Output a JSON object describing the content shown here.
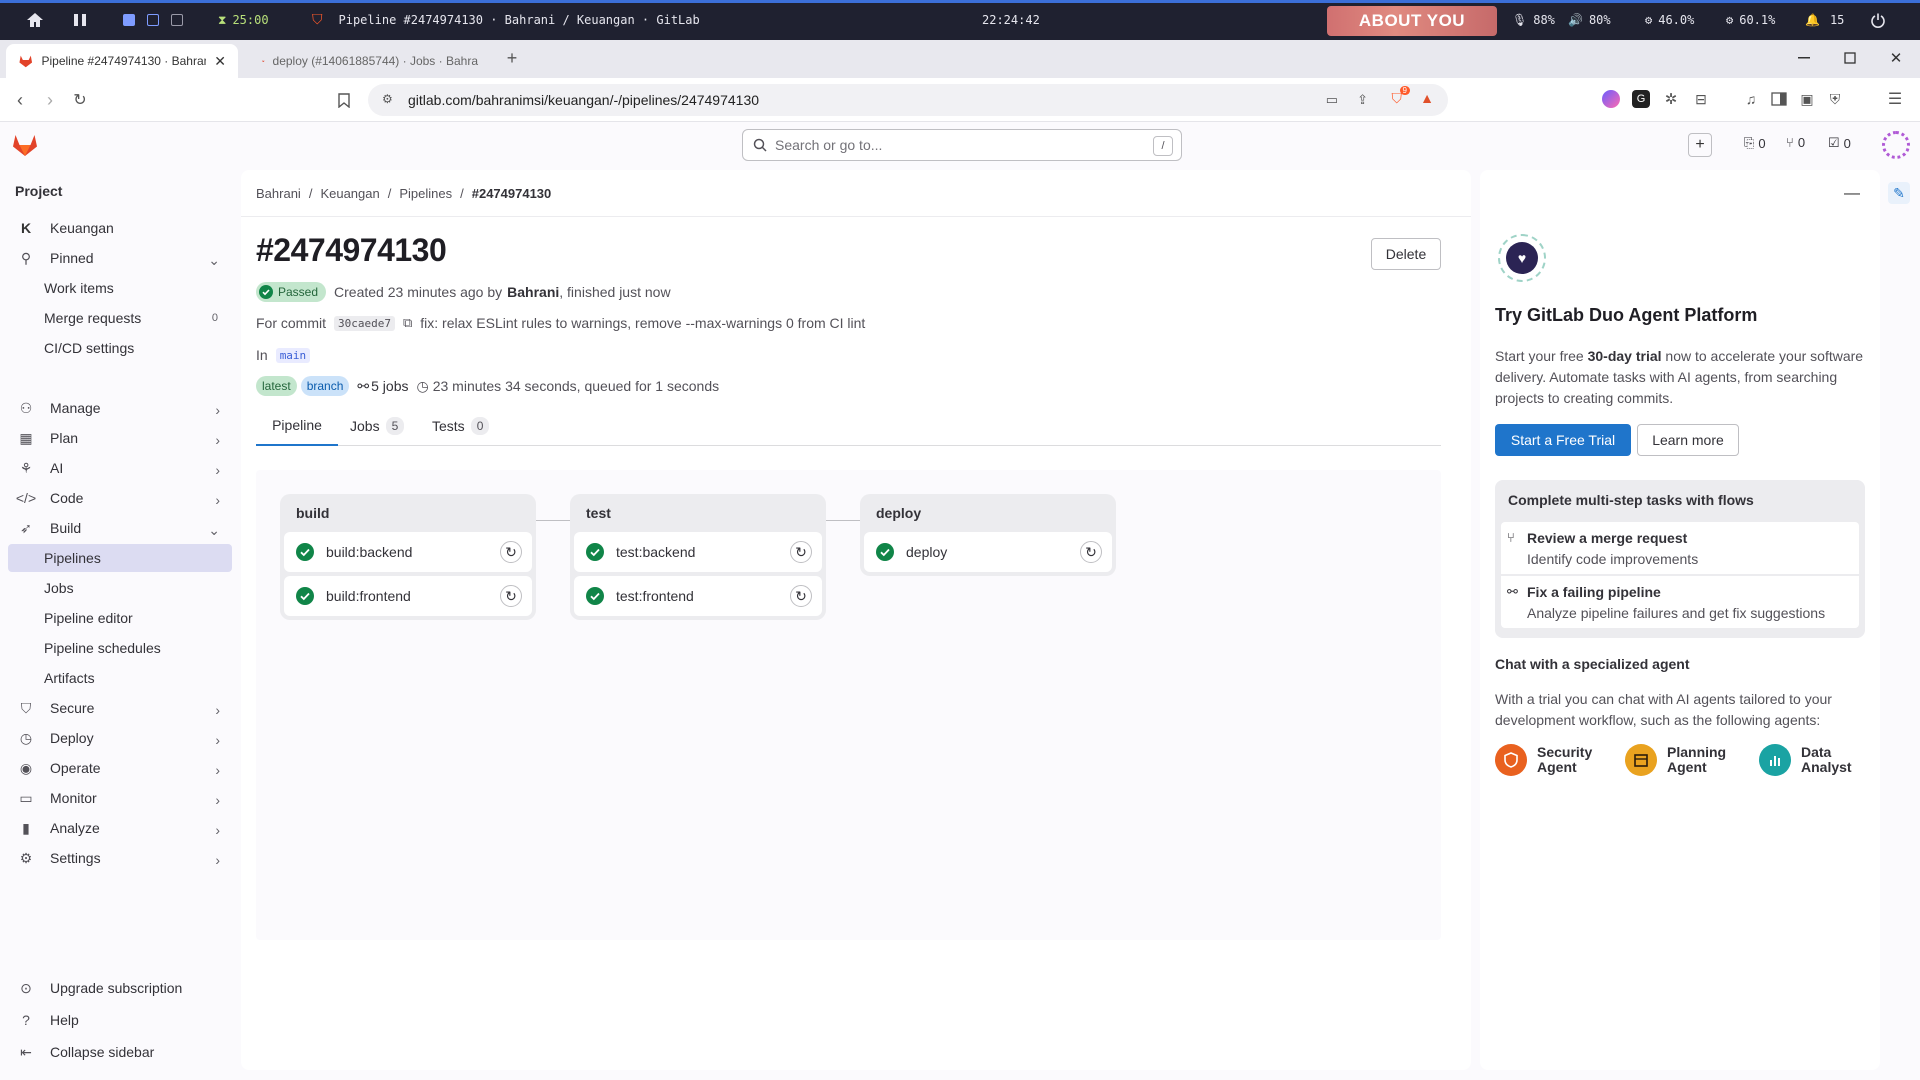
{
  "system": {
    "timer": "25:00",
    "window_title": "Pipeline #2474974130 · Bahrani / Keuangan · GitLab",
    "clock": "22:24:42",
    "media": "ABOUT YOU",
    "mic": "88%",
    "volume": "80%",
    "cpu": "46.0%",
    "mem": "60.1%",
    "notifications": "15"
  },
  "browser": {
    "tabs": [
      {
        "label": "Pipeline #2474974130 · Bahrani /"
      },
      {
        "label": "deploy (#14061885744) · Jobs · Bahra"
      }
    ],
    "url": "gitlab.com/bahranimsi/keuangan/-/pipelines/2474974130",
    "shield_badge": "9"
  },
  "header": {
    "search_placeholder": "Search or go to...",
    "search_shortcut": "/",
    "issues_count": "0",
    "mr_count": "0",
    "todos_count": "0"
  },
  "sidebar": {
    "title": "Project",
    "project_initial": "K",
    "project_name": "Keuangan",
    "pinned": "Pinned",
    "pinned_items": [
      {
        "label": "Work items"
      },
      {
        "label": "Merge requests",
        "count": "0"
      },
      {
        "label": "CI/CD settings"
      }
    ],
    "sections": [
      {
        "label": "Manage"
      },
      {
        "label": "Plan"
      },
      {
        "label": "AI"
      },
      {
        "label": "Code"
      },
      {
        "label": "Build"
      }
    ],
    "build_items": [
      {
        "label": "Pipelines"
      },
      {
        "label": "Jobs"
      },
      {
        "label": "Pipeline editor"
      },
      {
        "label": "Pipeline schedules"
      },
      {
        "label": "Artifacts"
      }
    ],
    "sections2": [
      {
        "label": "Secure"
      },
      {
        "label": "Deploy"
      },
      {
        "label": "Operate"
      },
      {
        "label": "Monitor"
      },
      {
        "label": "Analyze"
      },
      {
        "label": "Settings"
      }
    ],
    "footer": [
      {
        "label": "Upgrade subscription"
      },
      {
        "label": "Help"
      },
      {
        "label": "Collapse sidebar"
      }
    ]
  },
  "main": {
    "breadcrumb": [
      "Bahrani",
      "Keuangan",
      "Pipelines",
      "#2474974130"
    ],
    "title": "#2474974130",
    "delete_label": "Delete",
    "status": "Passed",
    "created_prefix": "Created 23 minutes ago by",
    "author": "Bahrani",
    "created_suffix": ", finished just now",
    "commit_prefix": "For commit",
    "commit_sha": "30caede7",
    "commit_message": "fix: relax ESLint rules to warnings, remove --max-warnings 0 from CI lint",
    "in_label": "In",
    "branch": "main",
    "tag_latest": "latest",
    "tag_branch": "branch",
    "jobs_count_label": "5 jobs",
    "duration": "23 minutes 34 seconds, queued for 1 seconds",
    "tabs": [
      {
        "label": "Pipeline"
      },
      {
        "label": "Jobs",
        "count": "5"
      },
      {
        "label": "Tests",
        "count": "0"
      }
    ],
    "stages": [
      {
        "name": "build",
        "jobs": [
          "build:backend",
          "build:frontend"
        ]
      },
      {
        "name": "test",
        "jobs": [
          "test:backend",
          "test:frontend"
        ]
      },
      {
        "name": "deploy",
        "jobs": [
          "deploy"
        ]
      }
    ]
  },
  "duo": {
    "title": "Try GitLab Duo Agent Platform",
    "intro_a": "Start your free",
    "intro_bold": "30-day trial",
    "intro_b": "now to accelerate your software delivery. Automate tasks with AI agents, from searching projects to creating commits.",
    "start_trial": "Start a Free Trial",
    "learn_more": "Learn more",
    "flows_title": "Complete multi-step tasks with flows",
    "flows": [
      {
        "title": "Review a merge request",
        "desc": "Identify code improvements"
      },
      {
        "title": "Fix a failing pipeline",
        "desc": "Analyze pipeline failures and get fix suggestions"
      }
    ],
    "chat_title": "Chat with a specialized agent",
    "chat_desc": "With a trial you can chat with AI agents tailored to your development workflow, such as the following agents:",
    "agents": [
      {
        "line1": "Security",
        "line2": "Agent",
        "color": "#e9611f"
      },
      {
        "line1": "Planning",
        "line2": "Agent",
        "color": "#e9a21f"
      },
      {
        "line1": "Data",
        "line2": "Analyst",
        "color": "#1aa3a3"
      }
    ]
  },
  "colors": {
    "accent": "#1f75cb",
    "success": "#108548",
    "gitlab_orange": "#e24329"
  }
}
